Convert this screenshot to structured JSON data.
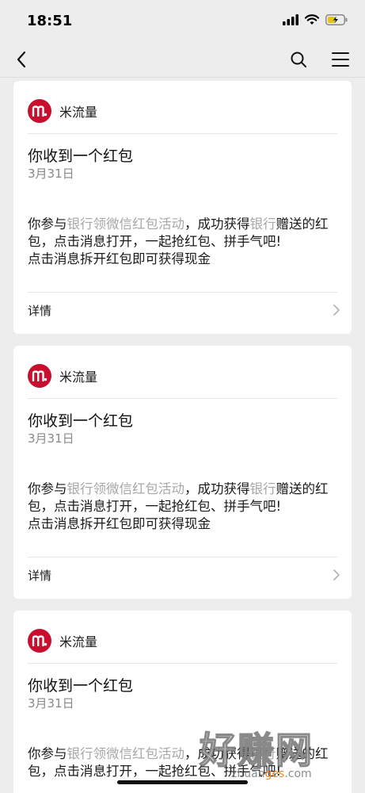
{
  "status_bar": {
    "time": "18:51"
  },
  "cards": [
    {
      "sender": "米流量",
      "title": "你收到一个红包",
      "date": "3月31日",
      "body": {
        "p1": "你参与",
        "g1": "银行领微信红包活动",
        "p2": "，成功获得",
        "g2": "银行",
        "p3": "赠送的红包，点击消息打开，一起抢红包、拼手气吧!",
        "line2": "点击消息拆开红包即可获得现金"
      },
      "details_label": "详情"
    },
    {
      "sender": "米流量",
      "title": "你收到一个红包",
      "date": "3月31日",
      "body": {
        "p1": "你参与",
        "g1": "银行领微信红包活动",
        "p2": "，成功获得",
        "g2": "银行",
        "p3": "赠送的红包，点击消息打开，一起抢红包、拼手气吧!",
        "line2": "点击消息拆开红包即可获得现金"
      },
      "details_label": "详情"
    },
    {
      "sender": "米流量",
      "title": "你收到一个红包",
      "date": "3月31日",
      "body": {
        "p1": "你参与",
        "g1": "银行领微信红包活动",
        "p2": "，成功获得",
        "g2": "银行",
        "p3": "赠送的红包，点击消息打开，一起抢红包、拼手气吧!",
        "line2": ""
      },
      "details_label": ""
    }
  ],
  "watermark": {
    "main": "好赚网",
    "sub_pre": "zhuan",
    "sub_orange": "ges",
    "sub_post": ".com"
  }
}
